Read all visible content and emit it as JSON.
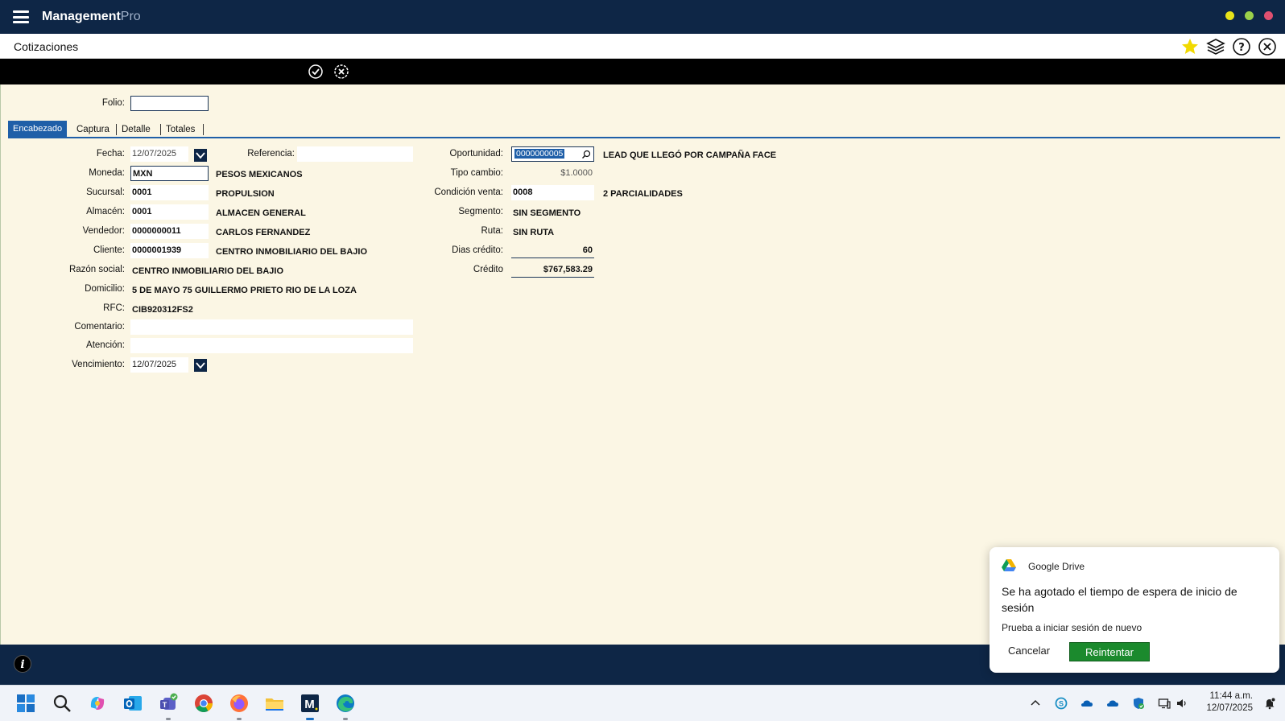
{
  "app": {
    "title_main": "Management",
    "title_suffix": "Pro"
  },
  "window_controls": {
    "colors": [
      "#e8e31a",
      "#9bd14a",
      "#e05070"
    ]
  },
  "header": {
    "page_title": "Cotizaciones",
    "icons": [
      "star-icon",
      "layers-icon",
      "help-icon",
      "close-icon"
    ],
    "star_color": "#f1d900"
  },
  "toolbar": {
    "icons": [
      "accept-icon",
      "cancel-icon"
    ]
  },
  "form": {
    "folio_label": "Folio:",
    "folio_value": "",
    "tabs": [
      "Encabezado",
      "Captura",
      "Detalle",
      "Totales"
    ],
    "active_tab": "Encabezado",
    "left": {
      "fecha_label": "Fecha:",
      "fecha_value": "12/07/2025",
      "referencia_label": "Referencia:",
      "referencia_value": "",
      "moneda_label": "Moneda:",
      "moneda_value": "MXN",
      "moneda_desc": "PESOS MEXICANOS",
      "sucursal_label": "Sucursal:",
      "sucursal_value": "0001",
      "sucursal_desc": "PROPULSION",
      "almacen_label": "Almacén:",
      "almacen_value": "0001",
      "almacen_desc": "ALMACEN GENERAL",
      "vendedor_label": "Vendedor:",
      "vendedor_value": "0000000011",
      "vendedor_desc": "CARLOS FERNANDEZ",
      "cliente_label": "Cliente:",
      "cliente_value": "0000001939",
      "cliente_desc": "CENTRO INMOBILIARIO DEL BAJIO",
      "razon_label": "Razón social:",
      "razon_value": "CENTRO INMOBILIARIO DEL BAJIO",
      "domicilio_label": "Domicilio:",
      "domicilio_value": "5 DE MAYO 75 GUILLERMO PRIETO RIO DE LA LOZA",
      "rfc_label": "RFC:",
      "rfc_value": "CIB920312FS2",
      "comentario_label": "Comentario:",
      "comentario_value": "",
      "atencion_label": "Atención:",
      "atencion_value": "",
      "vencimiento_label": "Vencimiento:",
      "vencimiento_value": "12/07/2025"
    },
    "right": {
      "oportunidad_label": "Oportunidad:",
      "oportunidad_value": "0000000005",
      "oportunidad_desc": "LEAD QUE LLEGÓ POR CAMPAÑA FACE",
      "tipo_cambio_label": "Tipo cambio:",
      "tipo_cambio_value": "$1.0000",
      "condicion_label": "Condición venta:",
      "condicion_value": "0008",
      "condicion_desc": "2 PARCIALIDADES",
      "segmento_label": "Segmento:",
      "segmento_value": "SIN SEGMENTO",
      "ruta_label": "Ruta:",
      "ruta_value": "SIN RUTA",
      "dias_label": "Dias crédito:",
      "dias_value": "60",
      "credito_label": "Crédito",
      "credito_value": "$767,583.29"
    }
  },
  "notification": {
    "source": "Google Drive",
    "message": "Se ha agotado el tiempo de espera de inicio de sesión",
    "sub": "Prueba a iniciar sesión de nuevo",
    "cancel_label": "Cancelar",
    "retry_label": "Reintentar"
  },
  "taskbar": {
    "apps": [
      "start-icon",
      "search-icon",
      "copilot-icon",
      "outlook-icon",
      "teams-icon",
      "chrome-icon",
      "firefox-icon",
      "file-explorer-icon",
      "management-app-icon",
      "edge-icon"
    ],
    "time": "11:44 a.m.",
    "date": "12/07/2025"
  }
}
